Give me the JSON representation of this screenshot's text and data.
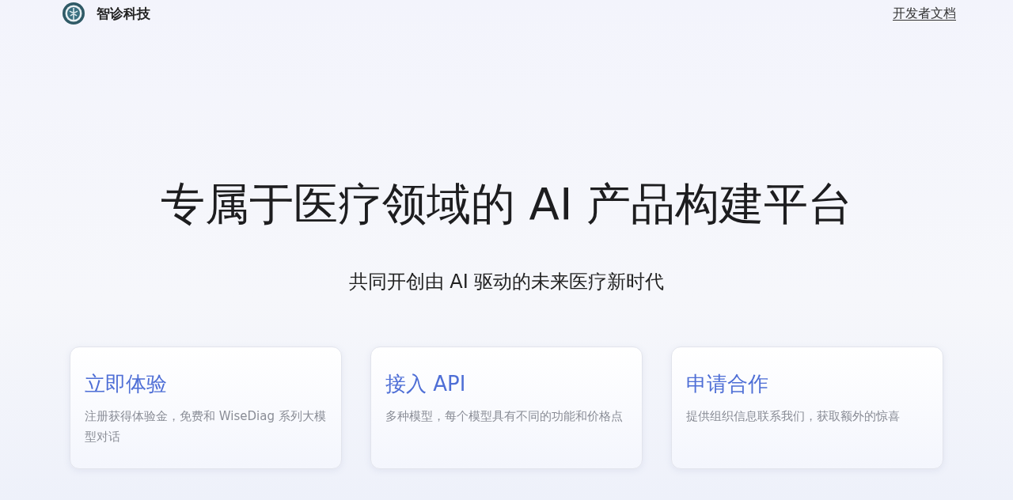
{
  "header": {
    "brand": "智诊科技",
    "link": "开发者文档"
  },
  "hero": {
    "title": "专属于医疗领域的 AI 产品构建平台",
    "subtitle": "共同开创由 AI 驱动的未来医疗新时代"
  },
  "cards": [
    {
      "title": "立即体验",
      "description": "注册获得体验金，免费和 WiseDiag 系列大模型对话"
    },
    {
      "title": "接入 API",
      "description": "多种模型，每个模型具有不同的功能和价格点"
    },
    {
      "title": "申请合作",
      "description": "提供组织信息联系我们，获取额外的惊喜"
    }
  ]
}
